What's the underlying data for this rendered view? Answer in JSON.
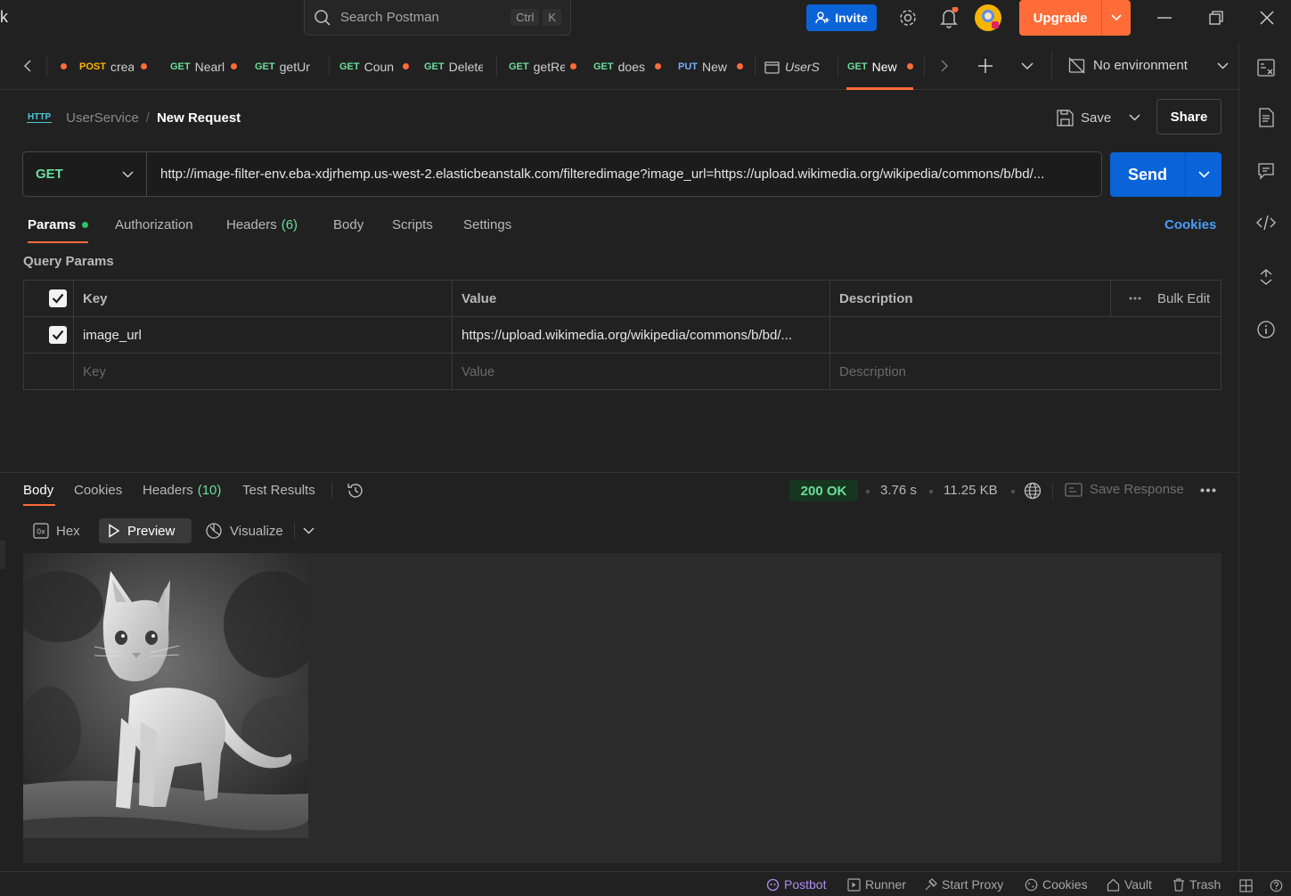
{
  "titlebar": {
    "app_title_fragment": "k",
    "search_placeholder": "Search Postman",
    "shortcut_keys": [
      "Ctrl",
      "K"
    ],
    "invite_label": "Invite",
    "upgrade_label": "Upgrade"
  },
  "tabs": [
    {
      "method": "POST",
      "name": "crea",
      "unsaved": true
    },
    {
      "method": "GET",
      "name": "Nearl",
      "unsaved": true
    },
    {
      "method": "GET",
      "name": "getUr",
      "unsaved": false
    },
    {
      "method": "GET",
      "name": "Coun",
      "unsaved": true
    },
    {
      "method": "GET",
      "name": "Delete",
      "unsaved": false
    },
    {
      "method": "GET",
      "name": "getRe",
      "unsaved": true
    },
    {
      "method": "GET",
      "name": "does",
      "unsaved": true
    },
    {
      "method": "PUT",
      "name": "New",
      "unsaved": true
    },
    {
      "method": "",
      "name": "UserS",
      "unsaved": false
    },
    {
      "method": "GET",
      "name": "New",
      "unsaved": true,
      "active": true
    }
  ],
  "environment": "No environment",
  "breadcrumb": {
    "collection": "UserService",
    "separator": "/",
    "request": "New Request",
    "protocol_badge": "HTTP"
  },
  "save_label": "Save",
  "share_label": "Share",
  "request": {
    "method": "GET",
    "url": "http://image-filter-env.eba-xdjrhemp.us-west-2.elasticbeanstalk.com/filteredimage?image_url=https://upload.wikimedia.org/wikipedia/commons/b/bd/...",
    "send_label": "Send"
  },
  "request_tabs": {
    "params": "Params",
    "authorization": "Authorization",
    "headers": "Headers",
    "headers_count": "(6)",
    "body": "Body",
    "scripts": "Scripts",
    "settings": "Settings",
    "cookies": "Cookies"
  },
  "query_params": {
    "title": "Query Params",
    "columns": {
      "key": "Key",
      "value": "Value",
      "description": "Description",
      "bulk_edit": "Bulk Edit"
    },
    "rows": [
      {
        "checked": true,
        "key": "image_url",
        "value": "https://upload.wikimedia.org/wikipedia/commons/b/bd/...",
        "description": ""
      }
    ],
    "placeholders": {
      "key": "Key",
      "value": "Value",
      "description": "Description"
    }
  },
  "response": {
    "tabs": {
      "body": "Body",
      "cookies": "Cookies",
      "headers": "Headers",
      "headers_count": "(10)",
      "test_results": "Test Results"
    },
    "status": "200 OK",
    "time": "3.76 s",
    "size": "11.25 KB",
    "save_response": "Save Response",
    "view_modes": {
      "hex": "Hex",
      "preview": "Preview",
      "visualize": "Visualize"
    }
  },
  "footer": {
    "postbot": "Postbot",
    "runner": "Runner",
    "start_proxy": "Start Proxy",
    "cookies": "Cookies",
    "vault": "Vault",
    "trash": "Trash"
  },
  "colors": {
    "accent_orange": "#ff6c37",
    "primary_blue": "#0b63d8",
    "get_green": "#6bdd9a",
    "post_yellow": "#ffb400",
    "put_blue": "#74aef6",
    "link_blue": "#4b9cf5"
  }
}
